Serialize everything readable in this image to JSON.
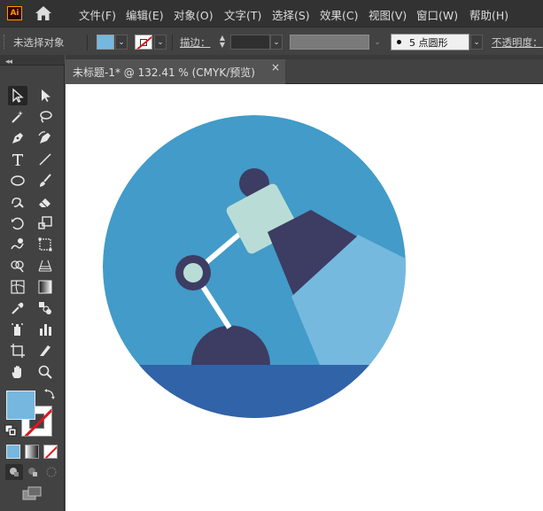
{
  "app": {
    "logo_text": "Ai"
  },
  "menu": {
    "items": [
      "文件(F)",
      "编辑(E)",
      "对象(O)",
      "文字(T)",
      "选择(S)",
      "效果(C)",
      "视图(V)",
      "窗口(W)",
      "帮助(H)"
    ]
  },
  "control_bar": {
    "selection_status": "未选择对象",
    "stroke_label": "描边：",
    "brush_profile_value": "5 点圆形",
    "opacity_label": "不透明度："
  },
  "document": {
    "tab_title": "未标题-1* @ 132.41 % (CMYK/预览)",
    "tab_close": "×"
  },
  "colors": {
    "fill": "#76b7e0",
    "stroke": "none",
    "illustration_circle": "#429bc8",
    "illustration_ground": "#3163a8",
    "illustration_dark": "#3d3c63",
    "illustration_shade": "#b9ddd6",
    "illustration_light_beam": "#75b9de",
    "illustration_joint": "#b9ddd6"
  },
  "toolbar": {
    "tools": [
      "selection-tool",
      "direct-selection-tool",
      "magic-wand-tool",
      "lasso-tool",
      "pen-tool",
      "curvature-tool",
      "type-tool",
      "line-segment-tool",
      "ellipse-tool",
      "paintbrush-tool",
      "shaper-tool",
      "eraser-tool",
      "rotate-tool",
      "scale-tool",
      "warp-tool",
      "free-transform-tool",
      "shape-builder-tool",
      "perspective-grid-tool",
      "mesh-tool",
      "gradient-tool",
      "eyedropper-tool",
      "blend-tool",
      "symbol-sprayer-tool",
      "column-graph-tool",
      "artboard-tool",
      "slice-tool",
      "hand-tool",
      "zoom-tool"
    ]
  }
}
